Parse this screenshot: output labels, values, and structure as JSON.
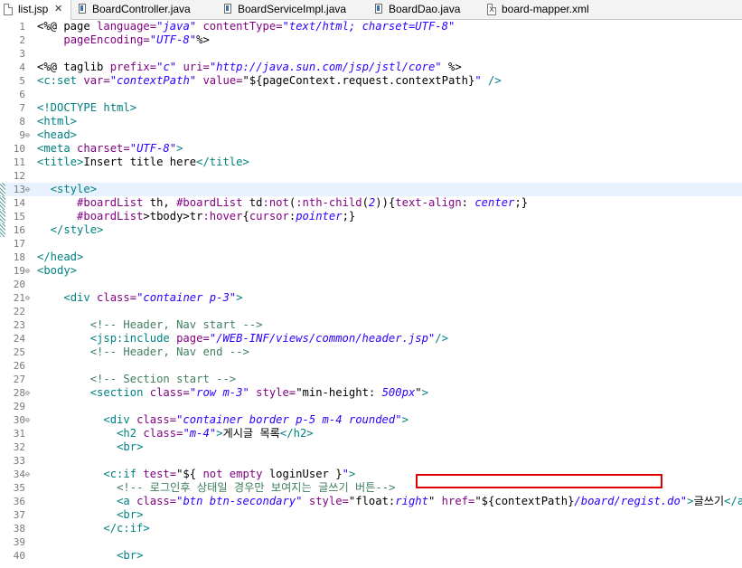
{
  "tabs": [
    {
      "label": "list.jsp",
      "icon": "jsp-file-icon",
      "active": true,
      "close": "✕"
    },
    {
      "label": "BoardController.java",
      "icon": "java-file-icon"
    },
    {
      "label": "BoardServiceImpl.java",
      "icon": "java-file-icon"
    },
    {
      "label": "BoardDao.java",
      "icon": "java-file-icon"
    },
    {
      "label": "board-mapper.xml",
      "icon": "xml-file-icon"
    }
  ],
  "lines": [
    {
      "n": "1",
      "fold": "",
      "tokens": [
        [
          "p",
          "<%@ page "
        ],
        [
          "a",
          "language="
        ],
        [
          "s",
          "\"java\""
        ],
        [
          "p",
          " "
        ],
        [
          "a",
          "contentType="
        ],
        [
          "s",
          "\"text/html; charset=UTF-8\""
        ]
      ]
    },
    {
      "n": "2",
      "fold": "",
      "tokens": [
        [
          "p",
          "    "
        ],
        [
          "a",
          "pageEncoding="
        ],
        [
          "s",
          "\"UTF-8\""
        ],
        [
          "p",
          "%>"
        ]
      ]
    },
    {
      "n": "3",
      "fold": "",
      "tokens": []
    },
    {
      "n": "4",
      "fold": "",
      "tokens": [
        [
          "p",
          "<%@ "
        ],
        [
          "p",
          "taglib "
        ],
        [
          "a",
          "prefix="
        ],
        [
          "s",
          "\"c\""
        ],
        [
          "p",
          " "
        ],
        [
          "a",
          "uri="
        ],
        [
          "s",
          "\"http://java.sun.com/jsp/jstl/core\""
        ],
        [
          "p",
          " %>"
        ]
      ]
    },
    {
      "n": "5",
      "fold": "",
      "tokens": [
        [
          "t",
          "<c:set "
        ],
        [
          "a",
          "var="
        ],
        [
          "s",
          "\"contextPath\""
        ],
        [
          "p",
          " "
        ],
        [
          "a",
          "value="
        ],
        [
          "p",
          "\"${pageContext.request.contextPath}"
        ],
        [
          "s",
          "\""
        ],
        [
          "t",
          " />"
        ]
      ]
    },
    {
      "n": "6",
      "fold": "",
      "tokens": []
    },
    {
      "n": "7",
      "fold": "",
      "tokens": [
        [
          "t",
          "<!DOCTYPE html>"
        ]
      ]
    },
    {
      "n": "8",
      "fold": "",
      "tokens": [
        [
          "t",
          "<html>"
        ]
      ]
    },
    {
      "n": "9",
      "fold": "⊖",
      "tokens": [
        [
          "t",
          "<head>"
        ]
      ]
    },
    {
      "n": "10",
      "fold": "",
      "tokens": [
        [
          "t",
          "<meta "
        ],
        [
          "a",
          "charset="
        ],
        [
          "s",
          "\"UTF-8\""
        ],
        [
          "t",
          ">"
        ]
      ]
    },
    {
      "n": "11",
      "fold": "",
      "tokens": [
        [
          "t",
          "<title>"
        ],
        [
          "p",
          "Insert title here"
        ],
        [
          "t",
          "</title>"
        ]
      ]
    },
    {
      "n": "12",
      "fold": "",
      "tokens": []
    },
    {
      "n": "13",
      "fold": "⊖",
      "strip": true,
      "hl": true,
      "tokens": [
        [
          "p",
          "  "
        ],
        [
          "t",
          "<style>"
        ]
      ]
    },
    {
      "n": "14",
      "fold": "",
      "strip": true,
      "tokens": [
        [
          "p",
          "      "
        ],
        [
          "a",
          "#boardList"
        ],
        [
          "p",
          " th, "
        ],
        [
          "a",
          "#boardList"
        ],
        [
          "p",
          " td"
        ],
        [
          "a",
          ":not"
        ],
        [
          "p",
          "("
        ],
        [
          "a",
          ":nth-child"
        ],
        [
          "p",
          "("
        ],
        [
          "s",
          "2"
        ],
        [
          "p",
          "))"
        ],
        [
          "p",
          "{"
        ],
        [
          "a",
          "text-align"
        ],
        [
          "p",
          ": "
        ],
        [
          "s",
          "center"
        ],
        [
          "p",
          ";}"
        ]
      ]
    },
    {
      "n": "15",
      "fold": "",
      "strip": true,
      "tokens": [
        [
          "p",
          "      "
        ],
        [
          "a",
          "#boardList"
        ],
        [
          "p",
          ">tbody>tr"
        ],
        [
          "a",
          ":hover"
        ],
        [
          "p",
          "{"
        ],
        [
          "a",
          "cursor"
        ],
        [
          "p",
          ":"
        ],
        [
          "s",
          "pointer"
        ],
        [
          "p",
          ";}"
        ]
      ]
    },
    {
      "n": "16",
      "fold": "",
      "strip": true,
      "tokens": [
        [
          "p",
          "  "
        ],
        [
          "t",
          "</style>"
        ]
      ]
    },
    {
      "n": "17",
      "fold": "",
      "tokens": []
    },
    {
      "n": "18",
      "fold": "",
      "tokens": [
        [
          "t",
          "</head>"
        ]
      ]
    },
    {
      "n": "19",
      "fold": "⊖",
      "tokens": [
        [
          "t",
          "<body>"
        ]
      ]
    },
    {
      "n": "20",
      "fold": "",
      "tokens": []
    },
    {
      "n": "21",
      "fold": "⊖",
      "tokens": [
        [
          "p",
          "    "
        ],
        [
          "t",
          "<div "
        ],
        [
          "a",
          "class="
        ],
        [
          "s",
          "\"container p-3\""
        ],
        [
          "t",
          ">"
        ]
      ]
    },
    {
      "n": "22",
      "fold": "",
      "tokens": []
    },
    {
      "n": "23",
      "fold": "",
      "tokens": [
        [
          "p",
          "        "
        ],
        [
          "d",
          "<!-- Header, Nav start -->"
        ]
      ]
    },
    {
      "n": "24",
      "fold": "",
      "tokens": [
        [
          "p",
          "        "
        ],
        [
          "t",
          "<jsp:include "
        ],
        [
          "a",
          "page="
        ],
        [
          "s",
          "\"/WEB-INF/views/common/header.jsp\""
        ],
        [
          "t",
          "/>"
        ]
      ]
    },
    {
      "n": "25",
      "fold": "",
      "tokens": [
        [
          "p",
          "        "
        ],
        [
          "d",
          "<!-- Header, Nav end -->"
        ]
      ]
    },
    {
      "n": "26",
      "fold": "",
      "tokens": []
    },
    {
      "n": "27",
      "fold": "",
      "tokens": [
        [
          "p",
          "        "
        ],
        [
          "d",
          "<!-- Section start -->"
        ]
      ]
    },
    {
      "n": "28",
      "fold": "⊖",
      "tokens": [
        [
          "p",
          "        "
        ],
        [
          "t",
          "<section "
        ],
        [
          "a",
          "class="
        ],
        [
          "s",
          "\"row m-3\""
        ],
        [
          "p",
          " "
        ],
        [
          "a",
          "style="
        ],
        [
          "p",
          "\"min-height: "
        ],
        [
          "s",
          "500px"
        ],
        [
          "p",
          "\""
        ],
        [
          "t",
          ">"
        ]
      ]
    },
    {
      "n": "29",
      "fold": "",
      "tokens": []
    },
    {
      "n": "30",
      "fold": "⊖",
      "tokens": [
        [
          "p",
          "          "
        ],
        [
          "t",
          "<div "
        ],
        [
          "a",
          "class="
        ],
        [
          "s",
          "\"container border p-5 m-4 rounded\""
        ],
        [
          "t",
          ">"
        ]
      ]
    },
    {
      "n": "31",
      "fold": "",
      "tokens": [
        [
          "p",
          "            "
        ],
        [
          "t",
          "<h2 "
        ],
        [
          "a",
          "class="
        ],
        [
          "s",
          "\"m-4\""
        ],
        [
          "t",
          ">"
        ],
        [
          "p",
          "게시글 목록"
        ],
        [
          "t",
          "</h2>"
        ]
      ]
    },
    {
      "n": "32",
      "fold": "",
      "tokens": [
        [
          "p",
          "            "
        ],
        [
          "t",
          "<br>"
        ]
      ]
    },
    {
      "n": "33",
      "fold": "",
      "tokens": []
    },
    {
      "n": "34",
      "fold": "⊖",
      "tokens": [
        [
          "p",
          "          "
        ],
        [
          "t",
          "<c:if "
        ],
        [
          "a",
          "test="
        ],
        [
          "p",
          "\"${ "
        ],
        [
          "a",
          "not empty"
        ],
        [
          "p",
          " loginUser }"
        ],
        [
          "s",
          "\""
        ],
        [
          "t",
          ">"
        ]
      ]
    },
    {
      "n": "35",
      "fold": "",
      "tokens": [
        [
          "p",
          "            "
        ],
        [
          "d",
          "<!-- 로그인후 상태일 경우만 보여지는 글쓰기 버튼-->"
        ]
      ]
    },
    {
      "n": "36",
      "fold": "",
      "tokens": [
        [
          "p",
          "            "
        ],
        [
          "t",
          "<a "
        ],
        [
          "a",
          "class="
        ],
        [
          "s",
          "\"btn btn-secondary\""
        ],
        [
          "p",
          " "
        ],
        [
          "a",
          "style="
        ],
        [
          "p",
          "\"float:"
        ],
        [
          "s",
          "right"
        ],
        [
          "p",
          "\" "
        ],
        [
          "a",
          "href="
        ],
        [
          "p",
          "\"${contextPath}"
        ],
        [
          "s",
          "/board/regist.do\""
        ],
        [
          "t",
          ">"
        ],
        [
          "p",
          "글쓰기"
        ],
        [
          "t",
          "</a>"
        ]
      ]
    },
    {
      "n": "37",
      "fold": "",
      "tokens": [
        [
          "p",
          "            "
        ],
        [
          "t",
          "<br>"
        ]
      ]
    },
    {
      "n": "38",
      "fold": "",
      "tokens": [
        [
          "p",
          "          "
        ],
        [
          "t",
          "</c:if>"
        ]
      ]
    },
    {
      "n": "39",
      "fold": "",
      "tokens": []
    },
    {
      "n": "40",
      "fold": "",
      "tokens": [
        [
          "p",
          "            "
        ],
        [
          "t",
          "<br>"
        ]
      ]
    }
  ]
}
